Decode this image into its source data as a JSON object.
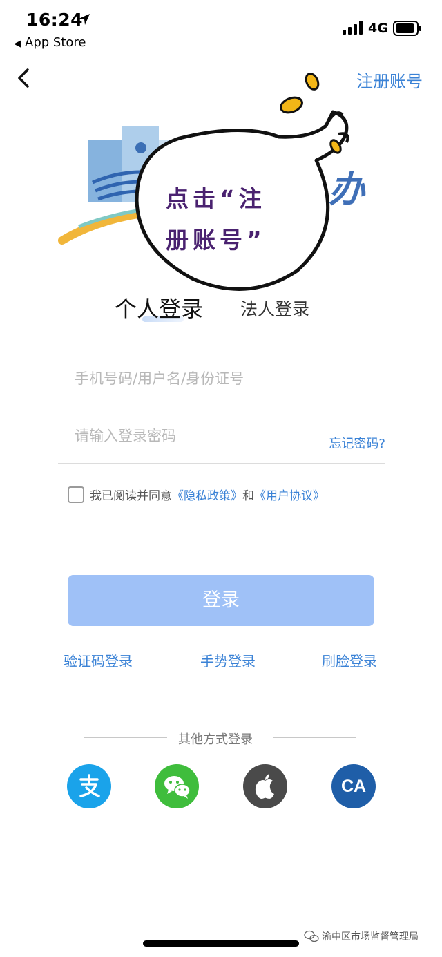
{
  "status_bar": {
    "time": "16:24",
    "back_app": "App Store",
    "network": "4G"
  },
  "nav": {
    "register": "注册账号"
  },
  "banner": {
    "bubble_text_line1": "点击“注",
    "bubble_text_line2": "册账号”",
    "logo_partial_text": "办"
  },
  "tabs": {
    "personal": "个人登录",
    "corporate": "法人登录"
  },
  "form": {
    "username_placeholder": "手机号码/用户名/身份证号",
    "password_placeholder": "请输入登录密码",
    "forgot": "忘记密码?",
    "agree_prefix": "我已阅读并同意",
    "privacy_link": "《隐私政策》",
    "agree_and": "和",
    "user_agreement_link": "《用户协议》",
    "login_button": "登录"
  },
  "alt_login": {
    "sms": "验证码登录",
    "gesture": "手势登录",
    "face": "刷脸登录"
  },
  "other": {
    "label": "其他方式登录",
    "icons": [
      "alipay-icon",
      "wechat-icon",
      "apple-icon",
      "ca-icon"
    ],
    "ca_text": "CA"
  },
  "watermark": "渝中区市场监督管理局",
  "colors": {
    "link": "#3a82d6",
    "login_button": "#9fc1f7",
    "alipay": "#1aa3ea",
    "wechat": "#3fbd3c",
    "apple": "#4a4a4a",
    "ca": "#1f5ea8"
  }
}
